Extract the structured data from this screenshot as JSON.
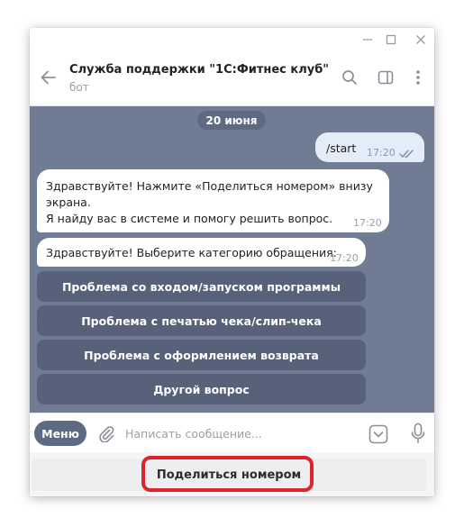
{
  "header": {
    "title": "Служба поддержки \"1С:Фитнес клуб\"",
    "subtitle": "бот"
  },
  "chat": {
    "date": "20 июня",
    "outgoing": {
      "text": "/start",
      "time": "17:20"
    },
    "incoming": [
      {
        "lines": [
          "Здравствуйте! Нажмите «Поделиться номером» внизу",
          "экрана.",
          "Я найду вас в системе и помогу решить вопрос."
        ],
        "time": "17:20"
      },
      {
        "lines": [
          "Здравствуйте! Выберите категорию обращения:"
        ],
        "time": "17:20"
      }
    ],
    "inline_buttons": [
      "Проблема со входом/запуском программы",
      "Проблема с печатью чека/слип-чека",
      "Проблема с оформлением возврата",
      "Другой вопрос"
    ]
  },
  "composer": {
    "menu_label": "Меню",
    "placeholder": "Написать сообщение..."
  },
  "reply_keyboard": {
    "button_label": "Поделиться номером"
  },
  "colors": {
    "chat_background": "#6f7c94",
    "inline_button": "#57627a",
    "menu_button": "#5e6a82",
    "highlight": "#e0232b"
  },
  "icons": [
    "minimize-icon",
    "maximize-icon",
    "close-icon",
    "back-arrow-icon",
    "search-icon",
    "sidebar-icon",
    "more-icon",
    "double-check-icon",
    "paperclip-icon",
    "keyboard-toggle-icon",
    "microphone-icon"
  ]
}
